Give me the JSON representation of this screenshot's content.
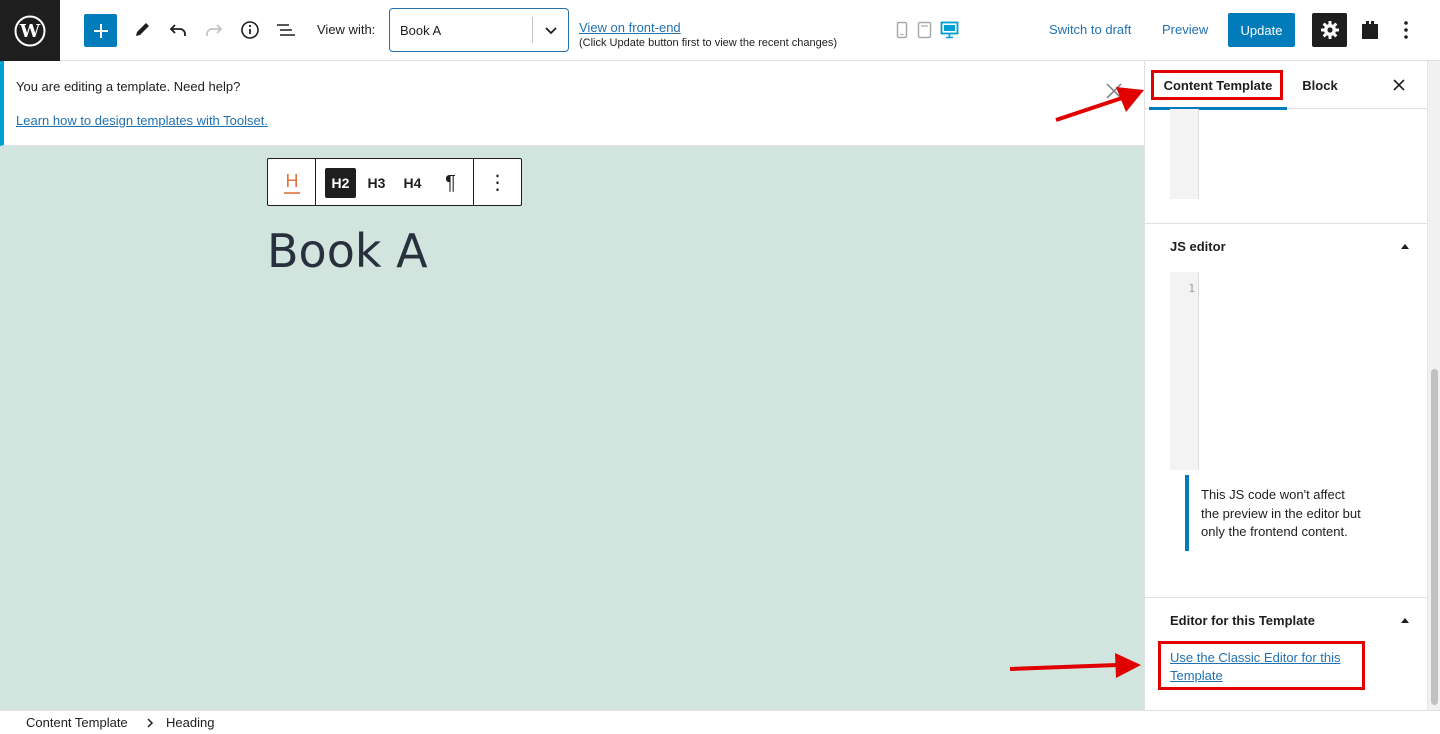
{
  "topbar": {
    "view_with_label": "View with:",
    "view_with_value": "Book A",
    "frontend_link": "View on front-end",
    "frontend_note": "(Click Update button first to view the recent changes)",
    "switch_to_draft": "Switch to draft",
    "preview": "Preview",
    "update": "Update",
    "accent_color": "#007cba"
  },
  "notice": {
    "message": "You are editing a template. Need help?",
    "help_link": "Learn how to design templates with Toolset."
  },
  "block_toolbar": {
    "h_icon": "H",
    "levels": [
      "H2",
      "H3",
      "H4"
    ],
    "paragraph": "¶",
    "more": "⋮",
    "active_level": "H2"
  },
  "content": {
    "heading": "Book A",
    "canvas_color": "#d1e4dd"
  },
  "sidebar": {
    "tabs": [
      "Content Template",
      "Block"
    ],
    "active_tab": "Content Template",
    "js_editor_title": "JS editor",
    "js_line_number": "1",
    "js_note": "This JS code won't affect the preview in the editor but only the frontend content.",
    "editor_panel_title": "Editor for this Template",
    "classic_editor_link": "Use the Classic Editor for this Template"
  },
  "breadcrumb": {
    "items": [
      "Content Template",
      "Heading"
    ]
  },
  "annotations": {
    "highlight_color": "#e00000"
  }
}
